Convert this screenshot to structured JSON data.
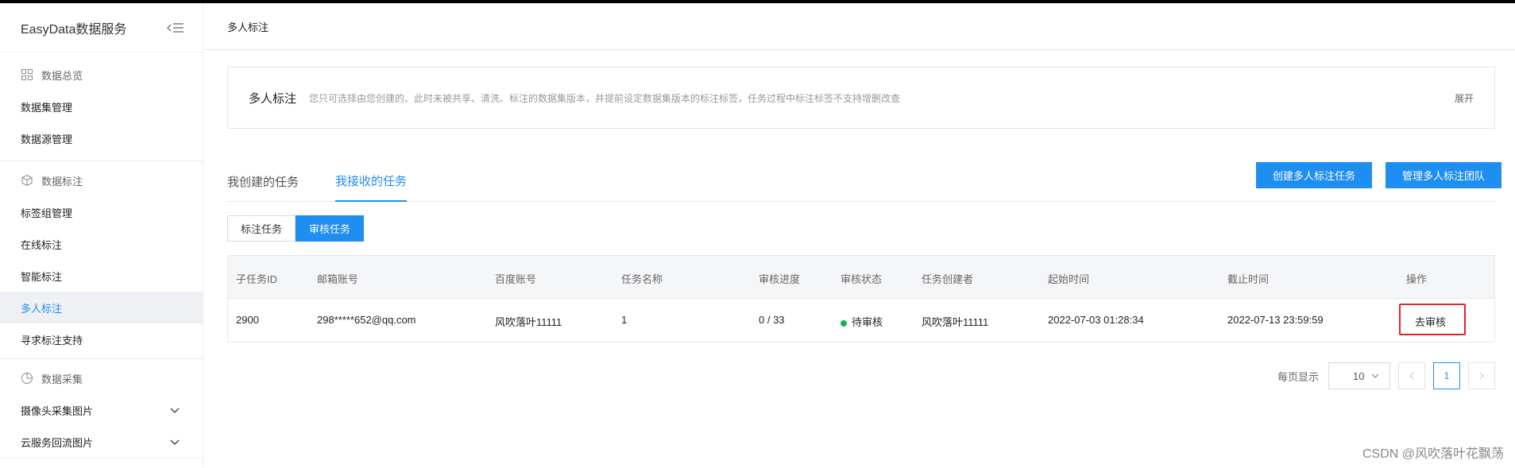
{
  "sidebar": {
    "brand": "EasyData数据服务",
    "groups": [
      {
        "title": "数据总览",
        "icon": "grid-icon",
        "items": [
          {
            "label": "数据集管理"
          },
          {
            "label": "数据源管理"
          }
        ]
      },
      {
        "title": "数据标注",
        "icon": "cube-icon",
        "items": [
          {
            "label": "标签组管理"
          },
          {
            "label": "在线标注"
          },
          {
            "label": "智能标注"
          },
          {
            "label": "多人标注",
            "active": true
          },
          {
            "label": "寻求标注支持"
          }
        ]
      },
      {
        "title": "数据采集",
        "icon": "pie-chart-icon",
        "items": [
          {
            "label": "摄像头采集图片",
            "expandable": true
          },
          {
            "label": "云服务回流图片",
            "expandable": true
          }
        ]
      }
    ]
  },
  "header": {
    "title": "多人标注"
  },
  "notice": {
    "title": "多人标注",
    "desc": "您只可选择由您创建的、此时未被共享、清洗、标注的数据集版本，并提前设定数据集版本的标注标签，任务过程中标注标签不支持增删改查",
    "expand": "展开"
  },
  "tabs": [
    {
      "label": "我创建的任务",
      "active": false
    },
    {
      "label": "我接收的任务",
      "active": true
    }
  ],
  "actions": {
    "create": "创建多人标注任务",
    "manage": "管理多人标注团队"
  },
  "segments": [
    {
      "label": "标注任务",
      "active": false
    },
    {
      "label": "审核任务",
      "active": true
    }
  ],
  "table": {
    "columns": [
      "子任务ID",
      "邮箱账号",
      "百度账号",
      "任务名称",
      "审核进度",
      "审核状态",
      "任务创建者",
      "起始时间",
      "截止时间",
      "操作"
    ],
    "rows": [
      {
        "id": "2900",
        "email": "298*****652@qq.com",
        "baidu": "风吹落叶11111",
        "name": "1",
        "progress": "0 / 33",
        "status": "待审核",
        "creator": "风吹落叶11111",
        "start": "2022-07-03 01:28:34",
        "end": "2022-07-13 23:59:59",
        "action": "去审核"
      }
    ]
  },
  "pagination": {
    "label": "每页显示",
    "page_size": "10",
    "current": "1"
  },
  "watermark": "CSDN @风吹落叶花飘荡",
  "colors": {
    "primary": "#1f8ef1",
    "status_ok": "#16b15a",
    "highlight": "#e42424"
  }
}
